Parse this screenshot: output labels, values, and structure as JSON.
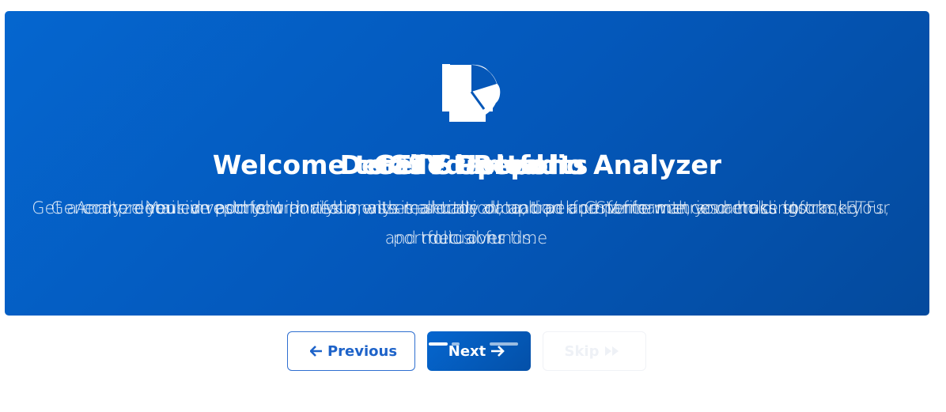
{
  "slides": [
    {
      "icon": "chart-line-icon",
      "title": "Welcome to ETF Portfolio Analyzer",
      "description": "Analyze your investment portfolio with real-time data, track performance, and make informed decisions"
    },
    {
      "icon": "upload-icon",
      "title": "Get Started",
      "description": "You can add your investments manually or upload a CSV file with your holdings"
    },
    {
      "icon": "file-icon",
      "title": "CSV Upload",
      "description": "Get a comprehensive portfolio analysis, asset allocation, and performance metrics across stocks, ETFs, and mutual funds."
    },
    {
      "icon": "pie-chart-icon",
      "title": "Detailed Reports",
      "description": "Generate detailed reports with risk analysis, sector allocation and performance metrics to track your portfolio over time"
    }
  ],
  "nav": {
    "previous_label": "Previous",
    "next_label": "Next",
    "skip_label": "Skip"
  },
  "progress": {
    "total_steps": 4,
    "current_step": 1
  },
  "colors": {
    "hero_start": "#0566cf",
    "hero_end": "#044a9d",
    "button_border": "#2f6fd0",
    "text_on_hero": "#ffffff"
  }
}
